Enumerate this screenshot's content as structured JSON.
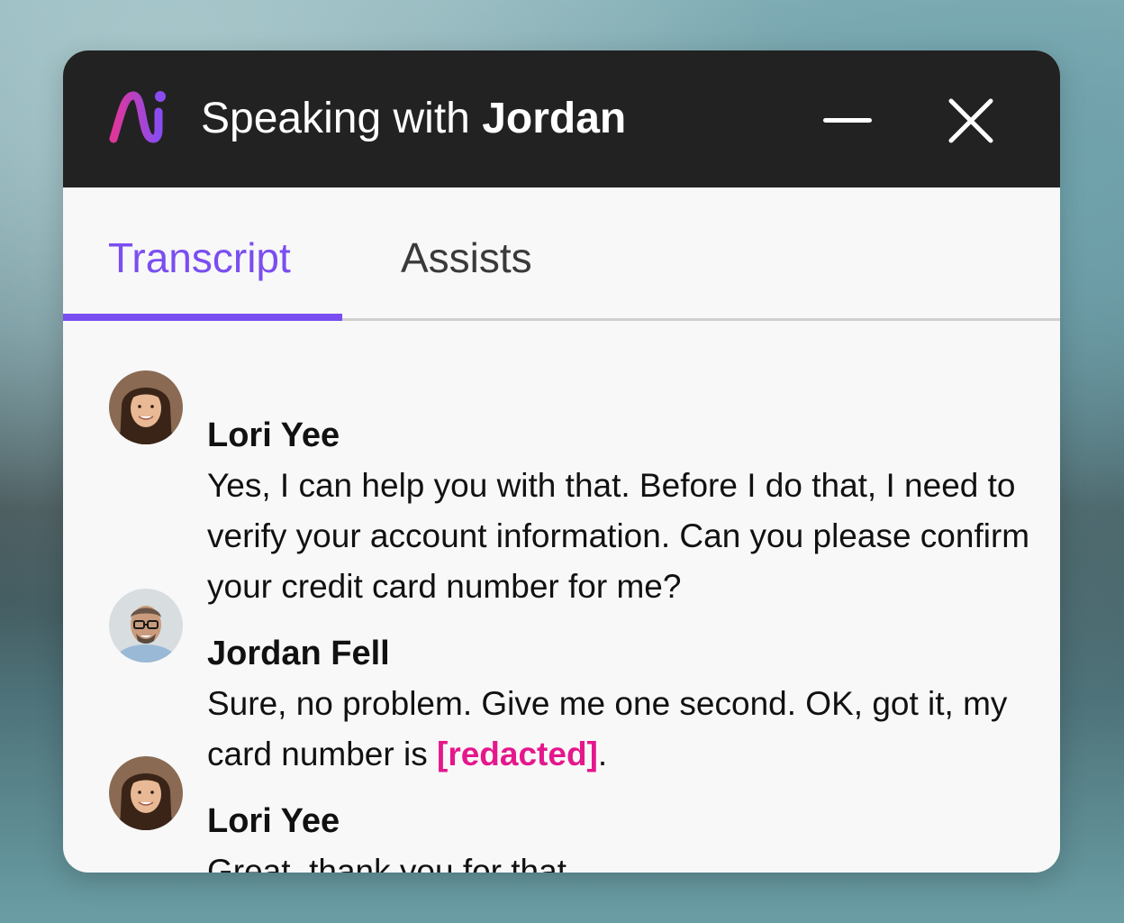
{
  "header": {
    "title_prefix": "Speaking with",
    "caller_name": "Jordan",
    "logo_icon": "ai-logo-icon",
    "minimize_icon": "minimize-icon",
    "close_icon": "close-icon"
  },
  "tabs": [
    {
      "label": "Transcript",
      "active": true
    },
    {
      "label": "Assists",
      "active": false
    }
  ],
  "colors": {
    "accent": "#7a4ef0",
    "redacted": "#e5178c",
    "header_bg": "#222222",
    "panel_bg": "#f8f8f8"
  },
  "messages": [
    {
      "speaker": "Lori Yee",
      "text": "Yes, I can help you with that. Before I do that, I need to verify your account information. Can you please confirm your credit card number for me?"
    },
    {
      "speaker": "Jordan Fell",
      "text_before": "Sure, no problem. Give me one second. OK, got it, my card number is ",
      "redacted": "[redacted]",
      "text_after": "."
    },
    {
      "speaker": "Lori Yee",
      "text": "Great, thank you for that."
    }
  ]
}
